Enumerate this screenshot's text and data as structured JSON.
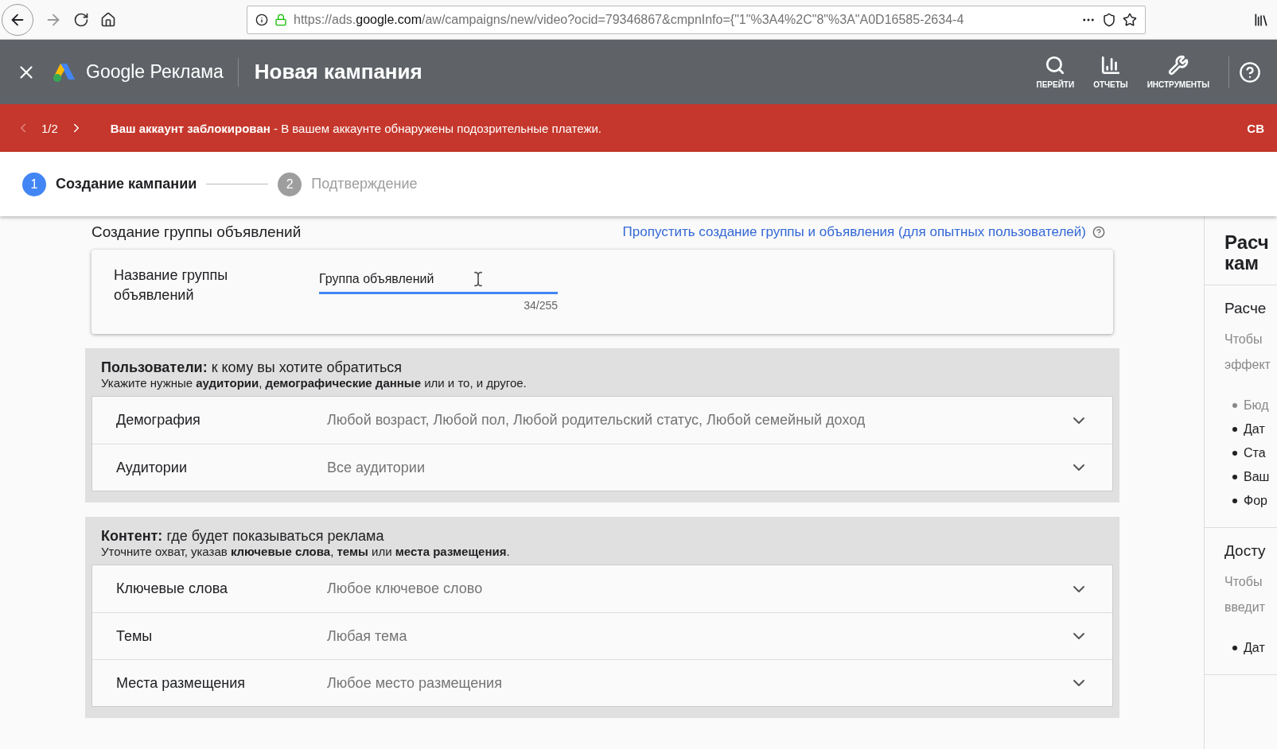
{
  "browser": {
    "url_prefix": "https://ads.",
    "url_domain": "google.com",
    "url_rest": "/aw/campaigns/new/video?ocid=79346867&cmpnInfo={\"1\"%3A4%2C\"8\"%3A\"A0D16585-2634-4"
  },
  "header": {
    "brand": "Google Реклама",
    "title": "Новая кампания",
    "tools": [
      {
        "kind": "search",
        "label": "ПЕРЕЙТИ"
      },
      {
        "kind": "reports",
        "label": "ОТЧЕТЫ"
      },
      {
        "kind": "tools",
        "label": "ИНСТРУМЕНТЫ"
      }
    ]
  },
  "banner": {
    "counter": "1/2",
    "message": "**Ваш аккаунт заблокирован** - В вашем аккаунте обнаружены подозрительные платежи.",
    "action": "СВ"
  },
  "stepper": [
    {
      "number": "1",
      "label": "Создание кампании",
      "selected": true
    },
    {
      "number": "2",
      "label": "Подтверждение",
      "selected": false
    }
  ],
  "section_heading": "Создание группы объявлений",
  "skip_link": "Пропустить создание группы и объявления (для опытных пользователей)",
  "name_field": {
    "label": "Название группы объявлений",
    "value": "Группа объявлений",
    "counter": "34/255",
    "focused": true
  },
  "sections": [
    {
      "title": "**Пользователи:** к кому вы хотите обратиться",
      "subtitle": "Укажите нужные **аудитории**, **демографические данные** или и то, и другое.",
      "rows": [
        {
          "label": "Демография",
          "value": "Любой возраст, Любой пол, Любой родительский статус, Любой семейный доход"
        },
        {
          "label": "Аудитории",
          "value": "Все аудитории"
        }
      ]
    },
    {
      "title": "**Контент:** где будет показываться реклама",
      "subtitle": "Уточните охват, указав **ключевые слова**, **темы** или **места размещения**.",
      "rows": [
        {
          "label": "Ключевые слова",
          "value": "Любое ключевое слово"
        },
        {
          "label": "Темы",
          "value": "Любая тема"
        },
        {
          "label": "Места размещения",
          "value": "Любое место размещения"
        }
      ]
    }
  ],
  "side_panel": {
    "title_lines": [
      "Расч",
      "кам"
    ],
    "blocks": [
      {
        "title": "Расче",
        "text_lines": [
          "Чтобы",
          "эффект"
        ],
        "bullets": [
          {
            "text": "Бюд",
            "muted": true
          },
          {
            "text": "Дат",
            "muted": false
          },
          {
            "text": "Ста",
            "muted": false
          },
          {
            "text": "Ваш",
            "muted": false
          },
          {
            "text": "Фор",
            "muted": false
          }
        ]
      },
      {
        "title": "Досту",
        "text_lines": [
          "Чтобы",
          "введит"
        ],
        "bullets": [
          {
            "text": "Дат",
            "muted": false
          }
        ]
      }
    ]
  }
}
